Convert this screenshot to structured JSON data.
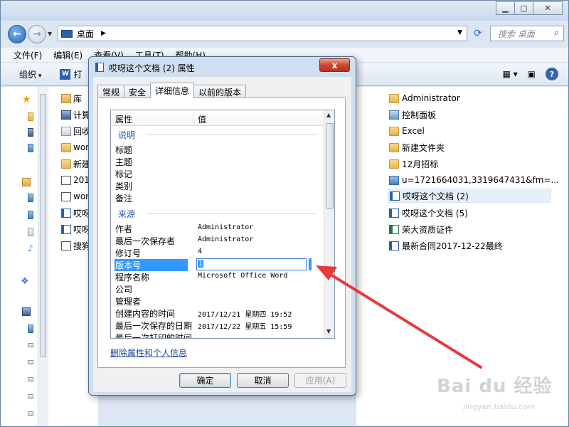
{
  "explorer": {
    "address": "桌面",
    "search_placeholder": "搜索 桌面",
    "menu": [
      "文件(F)",
      "编辑(E)",
      "查看(V)",
      "工具(T)",
      "帮助(H)"
    ],
    "toolbar": {
      "organize": "组织",
      "open_partial": "打"
    },
    "middle_items": [
      "库",
      "计算",
      "回收",
      "wor",
      "新建",
      "201",
      "wor",
      "哎呀",
      "哎呀",
      "搜狗"
    ],
    "right_items": [
      {
        "label": "Administrator",
        "icon": "folder-icon"
      },
      {
        "label": "控制面板",
        "icon": "control-panel-icon"
      },
      {
        "label": "Excel",
        "icon": "folder-icon"
      },
      {
        "label": "新建文件夹",
        "icon": "folder-icon"
      },
      {
        "label": "12月招标",
        "icon": "folder-icon"
      },
      {
        "label": "u=1721664031,3319647431&fm=...",
        "icon": "image-file-icon"
      },
      {
        "label": "哎呀这个文档 (2)",
        "icon": "word-file-icon",
        "selected": true
      },
      {
        "label": "哎呀这个文档 (5)",
        "icon": "word-file-icon"
      },
      {
        "label": "荣大资质证件",
        "icon": "excel-file-icon"
      },
      {
        "label": "最新合同2017-12-22最终",
        "icon": "word-file-icon"
      }
    ]
  },
  "dialog": {
    "title": "哎呀这个文档 (2) 属性",
    "close": "x",
    "tabs": [
      "常规",
      "安全",
      "详细信息",
      "以前的版本"
    ],
    "active_tab": "详细信息",
    "header": {
      "property": "属性",
      "value": "值"
    },
    "group_description": "说明",
    "group_origin": "来源",
    "description_rows": [
      {
        "k": "标题",
        "v": ""
      },
      {
        "k": "主题",
        "v": ""
      },
      {
        "k": "标记",
        "v": ""
      },
      {
        "k": "类别",
        "v": ""
      },
      {
        "k": "备注",
        "v": ""
      }
    ],
    "origin_rows": [
      {
        "k": "作者",
        "v": "Administrator"
      },
      {
        "k": "最后一次保存者",
        "v": "Administrator"
      },
      {
        "k": "修订号",
        "v": "4"
      },
      {
        "k": "版本号",
        "v": "1",
        "selected": true
      },
      {
        "k": "程序名称",
        "v": "Microsoft Office Word"
      },
      {
        "k": "公司",
        "v": ""
      },
      {
        "k": "管理者",
        "v": ""
      },
      {
        "k": "创建内容的时间",
        "v": "2017/12/21 星期四 19:52"
      },
      {
        "k": "最后一次保存的日期",
        "v": "2017/12/22 星期五 15:59"
      },
      {
        "k": "最后一次打印的时间",
        "v": ""
      }
    ],
    "remove_link": "删除属性和个人信息",
    "buttons": {
      "ok": "确定",
      "cancel": "取消",
      "apply": "应用(A)"
    }
  },
  "watermark": {
    "main": "Bai du 经验",
    "sub": "jingyan.baidu.com"
  },
  "colors": {
    "accent": "#3399ff",
    "arrow": "#e8393b",
    "link": "#1f4ba0"
  }
}
